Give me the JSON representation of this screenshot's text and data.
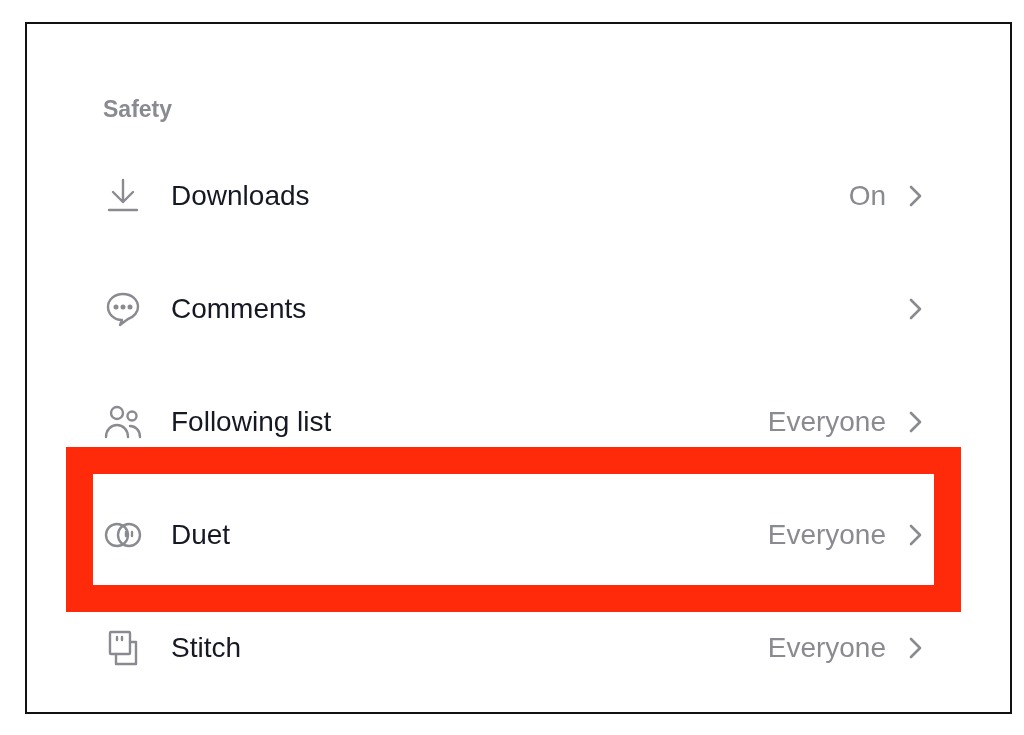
{
  "section": {
    "title": "Safety"
  },
  "rows": [
    {
      "kind": "downloads",
      "label": "Downloads",
      "value": "On",
      "highlighted": false
    },
    {
      "kind": "comments",
      "label": "Comments",
      "highlighted": false
    },
    {
      "kind": "following",
      "label": "Following list",
      "value": "Everyone",
      "highlighted": false
    },
    {
      "kind": "duet",
      "label": "Duet",
      "value": "Everyone",
      "highlighted": true
    },
    {
      "kind": "stitch",
      "label": "Stitch",
      "value": "Everyone",
      "highlighted": false
    }
  ]
}
